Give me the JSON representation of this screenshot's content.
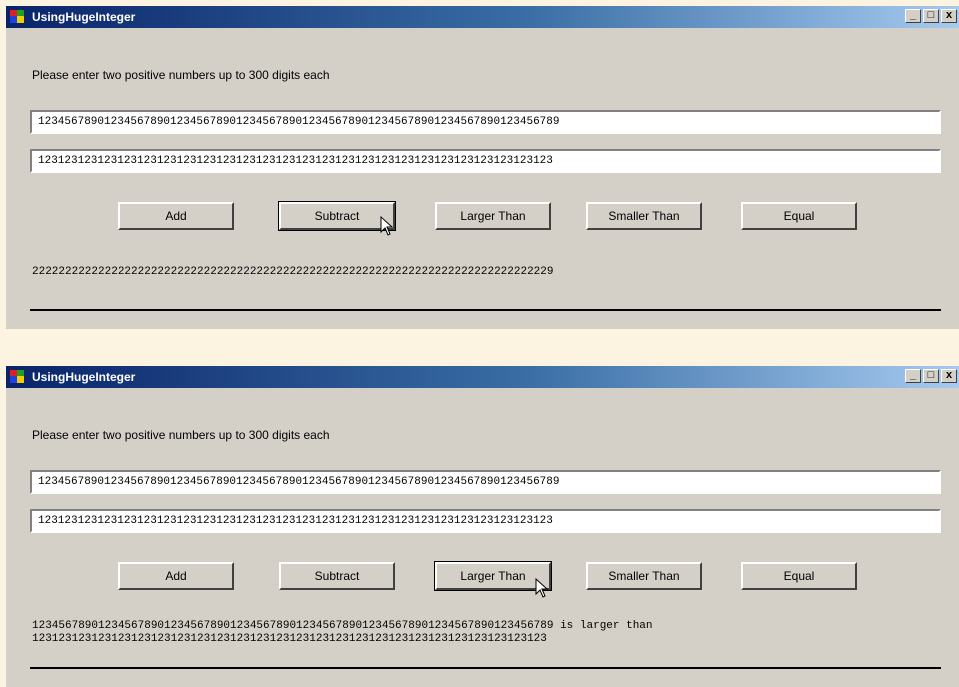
{
  "windows": [
    {
      "title": "UsingHugeInteger",
      "controls": {
        "minimize": "_",
        "maximize": "□",
        "close": "x"
      },
      "prompt": "Please enter two positive numbers up to 300 digits each",
      "input1": "1234567890123456789012345678901234567890123456789012345678901234567890123456789",
      "input2": "123123123123123123123123123123123123123123123123123123123123123123123123123123",
      "buttons": {
        "add": "Add",
        "subtract": "Subtract",
        "larger": "Larger Than",
        "smaller": "Smaller Than",
        "equal": "Equal"
      },
      "result": "2222222222222222222222222222222222222222222222222222222222222222222222222222229"
    },
    {
      "title": "UsingHugeInteger",
      "controls": {
        "minimize": "_",
        "maximize": "□",
        "close": "x"
      },
      "prompt": "Please enter two positive numbers up to 300 digits each",
      "input1": "1234567890123456789012345678901234567890123456789012345678901234567890123456789",
      "input2": "123123123123123123123123123123123123123123123123123123123123123123123123123123",
      "buttons": {
        "add": "Add",
        "subtract": "Subtract",
        "larger": "Larger Than",
        "smaller": "Smaller Than",
        "equal": "Equal"
      },
      "result_line1": "1234567890123456789012345678901234567890123456789012345678901234567890123456789 is larger than",
      "result_line2": "123123123123123123123123123123123123123123123123123123123123123123123123123123"
    }
  ]
}
